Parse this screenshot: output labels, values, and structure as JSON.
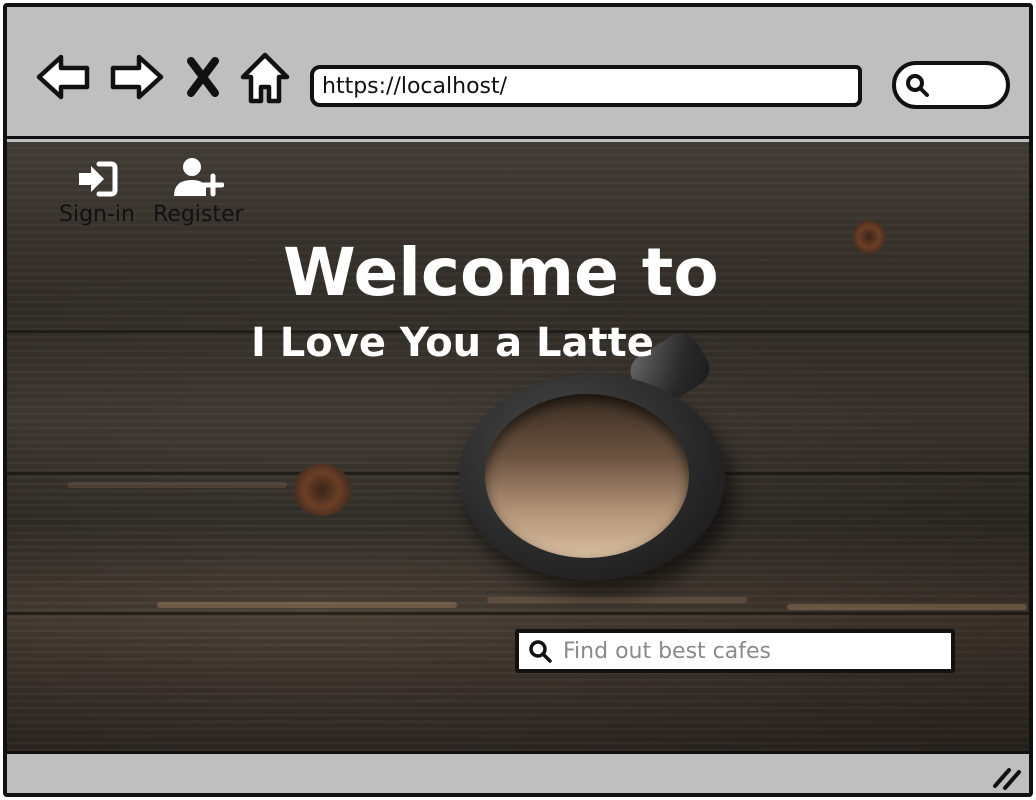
{
  "browser": {
    "url": "https://localhost/",
    "nav": {
      "back_icon": "arrow-left-icon",
      "forward_icon": "arrow-right-icon",
      "close_icon": "close-icon",
      "home_icon": "home-icon"
    },
    "search_icon": "search-icon"
  },
  "header": {
    "signin": {
      "label": "Sign-in",
      "icon": "sign-in-icon"
    },
    "register": {
      "label": "Register",
      "icon": "user-plus-icon"
    }
  },
  "hero": {
    "welcome": "Welcome to",
    "brand": "I Love You a Latte",
    "search": {
      "placeholder": "Find out best cafes",
      "value": "",
      "icon": "search-icon"
    }
  },
  "statusbar": {
    "grip_icon": "resize-grip-icon"
  }
}
